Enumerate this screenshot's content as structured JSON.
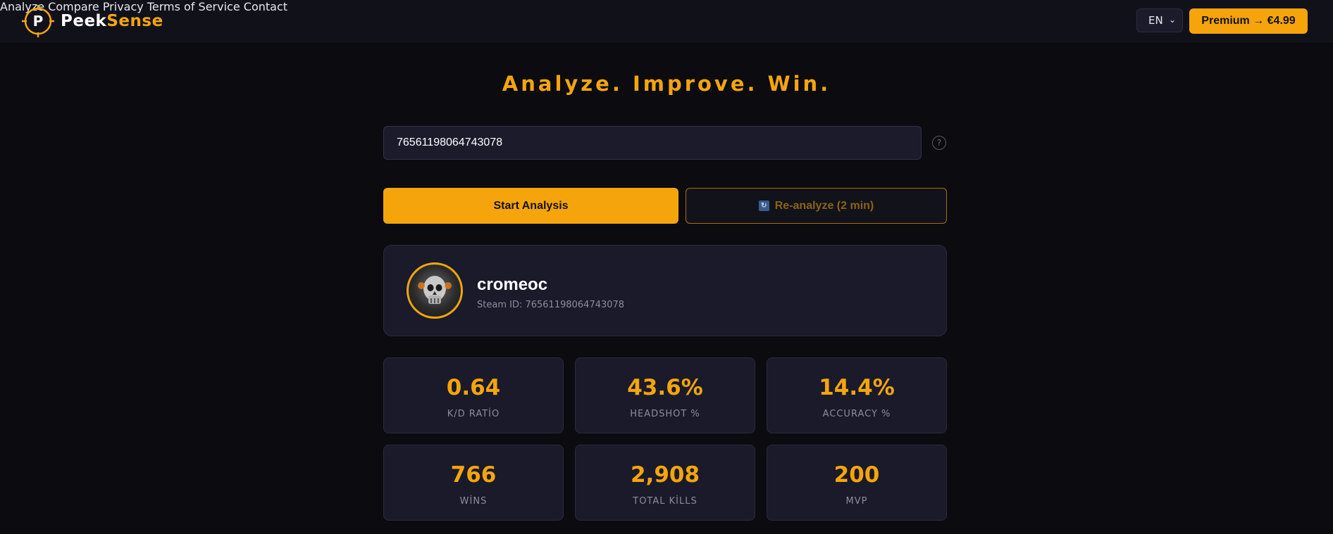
{
  "brand": {
    "name_part1": "Peek",
    "name_part2": "Sense",
    "logo_letter": "P"
  },
  "nav": {
    "items": [
      "Analyze",
      "Compare",
      "Privacy",
      "Terms of Service",
      "Contact"
    ],
    "language": "EN",
    "premium_label": "Premium → €4.99"
  },
  "hero": {
    "headline": "Analyze. Improve. Win."
  },
  "search": {
    "value": "76561198064743078",
    "help": "?"
  },
  "actions": {
    "start_label": "Start Analysis",
    "reanalyze_label": "Re-analyze (2 min)"
  },
  "profile": {
    "username": "cromeoc",
    "steam_id": "Steam ID: 76561198064743078"
  },
  "stats": [
    {
      "value": "0.64",
      "label": "K/D RATİO"
    },
    {
      "value": "43.6%",
      "label": "HEADSHOT %"
    },
    {
      "value": "14.4%",
      "label": "ACCURACY %"
    },
    {
      "value": "766",
      "label": "WİNS"
    },
    {
      "value": "2,908",
      "label": "TOTAL KİLLS"
    },
    {
      "value": "200",
      "label": "MVP"
    }
  ],
  "colors": {
    "accent": "#f5a50b",
    "background": "#0b0b10",
    "card": "#1a1a2a"
  }
}
